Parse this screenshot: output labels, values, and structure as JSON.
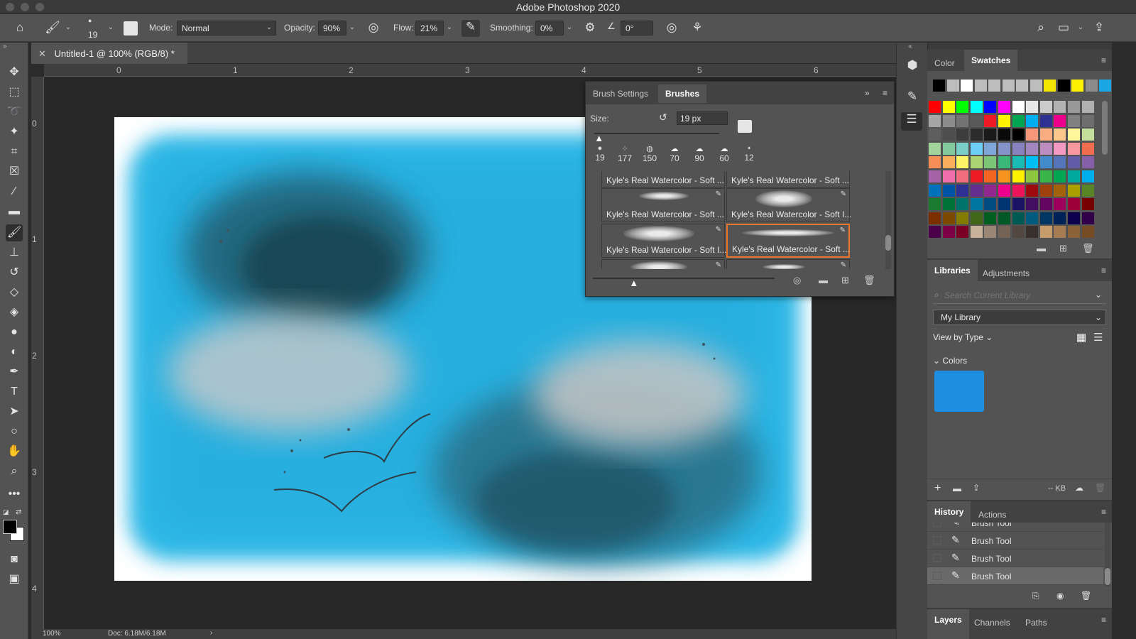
{
  "app": {
    "title": "Adobe Photoshop 2020"
  },
  "options": {
    "brush_size": "19",
    "mode_label": "Mode:",
    "mode_value": "Normal",
    "opacity_label": "Opacity:",
    "opacity_value": "90%",
    "flow_label": "Flow:",
    "flow_value": "21%",
    "smoothing_label": "Smoothing:",
    "smoothing_value": "0%",
    "angle_value": "0°"
  },
  "document": {
    "tab_title": "Untitled-1 @ 100% (RGB/8) *",
    "zoom": "100%",
    "doc_info": "Doc: 6.18M/6.18M"
  },
  "rulers": {
    "top": [
      "0",
      "1",
      "2",
      "3",
      "4",
      "5",
      "6"
    ],
    "left": [
      "0",
      "1",
      "2",
      "3",
      "4"
    ]
  },
  "brush_panel": {
    "tabs": [
      "Brush Settings",
      "Brushes"
    ],
    "active_tab": "Brushes",
    "size_label": "Size:",
    "size_value": "19 px",
    "size_fraction": 0.03,
    "preview_fraction": 0.22,
    "recent_sizes": [
      "19",
      "177",
      "150",
      "70",
      "90",
      "60",
      "12"
    ],
    "brushes": [
      "Kyle's Real Watercolor - Soft ...",
      "Kyle's Real Watercolor - Soft ...",
      "Kyle's Real Watercolor - Soft ...",
      "Kyle's Real Watercolor - Soft I...",
      "Kyle's Real Watercolor - Soft I...",
      "Kyle's Real Watercolor - Soft ..."
    ],
    "selected_index": 5
  },
  "color_panel": {
    "tabs": [
      "Color",
      "Swatches"
    ],
    "active_tab": "Swatches",
    "recent": [
      "#000000",
      "#bdbdbd",
      "#ffffff",
      "#bdbdbd",
      "#bdbdbd",
      "#bdbdbd",
      "#bdbdbd",
      "#bdbdbd",
      "#f2e500",
      "#000000",
      "#fff200",
      "#8c8c8c",
      "#1aa7e6"
    ],
    "grid": [
      [
        "#ff0000",
        "#ffff00",
        "#00ff00",
        "#00ffff",
        "#0000ff",
        "#ff00ff",
        "#ffffff",
        "#e6e6e6",
        "#cccccc",
        "#b3b3b3",
        "#999999",
        "#b0b0b0"
      ],
      [
        "#a6a6a6",
        "#8c8c8c",
        "#737373",
        "#595959",
        "#ed1c24",
        "#fff200",
        "#00a651",
        "#00aeef",
        "#2e3192",
        "#ec008c",
        "#808080",
        "#6e6e6e"
      ],
      [
        "#5e5e5e",
        "#4d4d4d",
        "#3d3d3d",
        "#2b2b2b",
        "#1a1a1a",
        "#0a0a0a",
        "#000000",
        "#f7977a",
        "#f9ad81",
        "#fdc68a",
        "#fff79a",
        "#c4df9b"
      ],
      [
        "#a2d39c",
        "#82ca9d",
        "#7bcdc8",
        "#6ecff6",
        "#7ea7d8",
        "#8493ca",
        "#8882be",
        "#a187be",
        "#bc8dbf",
        "#f49ac2",
        "#f6989d",
        "#f26c4f"
      ],
      [
        "#f68e55",
        "#fbaf5c",
        "#fff467",
        "#acd372",
        "#7cc576",
        "#3bb878",
        "#1abbb4",
        "#00bff3",
        "#438ccb",
        "#5574b9",
        "#605ca8",
        "#855fa8"
      ],
      [
        "#a763a8",
        "#f06ea9",
        "#f26d7d",
        "#ed1c24",
        "#f26522",
        "#f7941d",
        "#fff200",
        "#8dc73f",
        "#39b54a",
        "#00a651",
        "#00a99d",
        "#00aeef"
      ],
      [
        "#0072bc",
        "#0054a6",
        "#2e3192",
        "#662d91",
        "#92278f",
        "#ec008c",
        "#ed145b",
        "#9e0b0f",
        "#a0410d",
        "#a3620a",
        "#aba000",
        "#598527"
      ],
      [
        "#1a7b30",
        "#007236",
        "#00746b",
        "#0076a3",
        "#004b80",
        "#003471",
        "#1b1464",
        "#440e62",
        "#630460",
        "#9e005d",
        "#9e0039",
        "#790000"
      ],
      [
        "#7b2e00",
        "#7d4900",
        "#827b00",
        "#406618",
        "#005e20",
        "#005826",
        "#005952",
        "#005b7f",
        "#003663",
        "#002157",
        "#0d004c",
        "#32004b"
      ],
      [
        "#4b0049",
        "#7b0046",
        "#7a0026",
        "#c7b299",
        "#998675",
        "#736357",
        "#534741",
        "#37302d",
        "#c69c6d",
        "#a67c52",
        "#8c6239",
        "#754c24"
      ]
    ]
  },
  "libraries_panel": {
    "tabs": [
      "Libraries",
      "Adjustments"
    ],
    "active_tab": "Libraries",
    "search_placeholder": "Search Current Library",
    "library_name": "My Library",
    "view_by": "View by Type",
    "section": "Colors",
    "swatch_color": "#1e8fe0",
    "size_label": "-- KB"
  },
  "history_panel": {
    "tabs": [
      "History",
      "Actions"
    ],
    "active_tab": "History",
    "items": [
      "Brush Tool",
      "Brush Tool",
      "Brush Tool",
      "Brush Tool"
    ]
  },
  "layers_panel": {
    "tabs": [
      "Layers",
      "Channels",
      "Paths"
    ],
    "active_tab": "Layers"
  }
}
